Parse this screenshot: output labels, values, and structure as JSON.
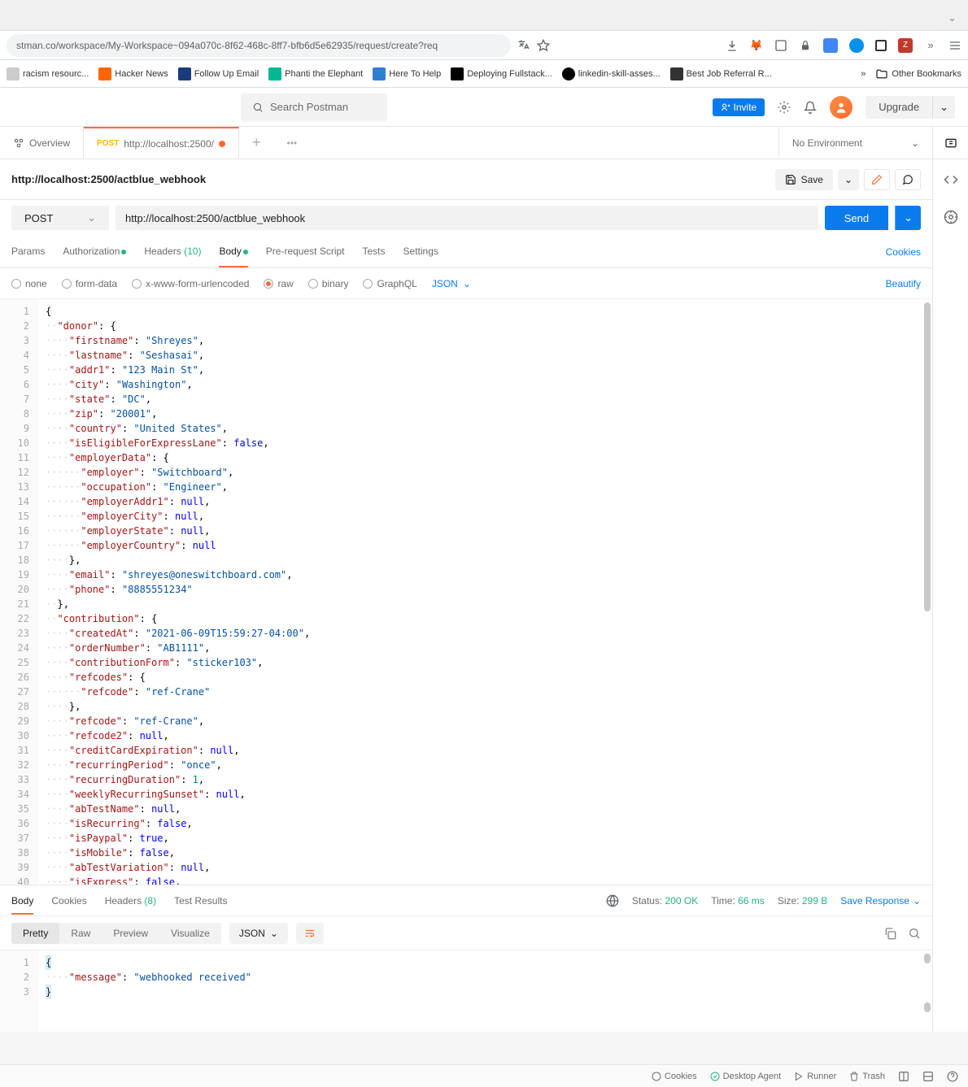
{
  "browser": {
    "url": "stman.co/workspace/My-Workspace~094a070c-8f62-468c-8ff7-bfb6d5e62935/request/create?req"
  },
  "bookmarks": [
    {
      "label": "racism resourc...",
      "cls": ""
    },
    {
      "label": "Hacker News",
      "cls": "orange"
    },
    {
      "label": "Follow Up Email",
      "cls": "darkblue"
    },
    {
      "label": "Phanti the Elephant",
      "cls": "teal"
    },
    {
      "label": "Here To Help",
      "cls": "blue"
    },
    {
      "label": "Deploying Fullstack...",
      "cls": "black"
    },
    {
      "label": "linkedin-skill-asses...",
      "cls": "github"
    },
    {
      "label": "Best Job Referral R...",
      "cls": "darkred"
    }
  ],
  "bookmarks_more": "Other Bookmarks",
  "pm": {
    "search_placeholder": "Search Postman",
    "invite": "Invite",
    "upgrade": "Upgrade",
    "overview": "Overview",
    "tab_method": "POST",
    "tab_url": "http://localhost:2500/",
    "env": "No Environment",
    "req_title": "http://localhost:2500/actblue_webhook",
    "save": "Save",
    "method": "POST",
    "url": "http://localhost:2500/actblue_webhook",
    "send": "Send",
    "req_tabs": {
      "params": "Params",
      "auth": "Authorization",
      "headers": "Headers",
      "headers_count": "(10)",
      "body": "Body",
      "prereq": "Pre-request Script",
      "tests": "Tests",
      "settings": "Settings",
      "cookies": "Cookies"
    },
    "body_types": {
      "none": "none",
      "formdata": "form-data",
      "xwww": "x-www-form-urlencoded",
      "raw": "raw",
      "binary": "binary",
      "graphql": "GraphQL",
      "json": "JSON",
      "beautify": "Beautify"
    }
  },
  "request_json_lines": [
    "{",
    "  \"donor\": {",
    "    \"firstname\": \"Shreyes\",",
    "    \"lastname\": \"Seshasai\",",
    "    \"addr1\": \"123 Main St\",",
    "    \"city\": \"Washington\",",
    "    \"state\": \"DC\",",
    "    \"zip\": \"20001\",",
    "    \"country\": \"United States\",",
    "    \"isEligibleForExpressLane\": false,",
    "    \"employerData\": {",
    "      \"employer\": \"Switchboard\",",
    "      \"occupation\": \"Engineer\",",
    "      \"employerAddr1\": null,",
    "      \"employerCity\": null,",
    "      \"employerState\": null,",
    "      \"employerCountry\": null",
    "    },",
    "    \"email\": \"shreyes@oneswitchboard.com\",",
    "    \"phone\": \"8885551234\"",
    "  },",
    "  \"contribution\": {",
    "    \"createdAt\": \"2021-06-09T15:59:27-04:00\",",
    "    \"orderNumber\": \"AB1111\",",
    "    \"contributionForm\": \"sticker103\",",
    "    \"refcodes\": {",
    "      \"refcode\": \"ref-Crane\"",
    "    },",
    "    \"refcode\": \"ref-Crane\",",
    "    \"refcode2\": null,",
    "    \"creditCardExpiration\": null,",
    "    \"recurringPeriod\": \"once\",",
    "    \"recurringDuration\": 1,",
    "    \"weeklyRecurringSunset\": null,",
    "    \"abTestName\": null,",
    "    \"isRecurring\": false,",
    "    \"isPaypal\": true,",
    "    \"isMobile\": false,",
    "    \"abTestVariation\": null,",
    "    \"isExpress\": false,"
  ],
  "response": {
    "tab_body": "Body",
    "tab_cookies": "Cookies",
    "tab_headers": "Headers",
    "tab_headers_count": "(8)",
    "tab_tests": "Test Results",
    "status_label": "Status:",
    "status_val": "200 OK",
    "time_label": "Time:",
    "time_val": "66 ms",
    "size_label": "Size:",
    "size_val": "299 B",
    "save_response": "Save Response",
    "views": {
      "pretty": "Pretty",
      "raw": "Raw",
      "preview": "Preview",
      "visualize": "Visualize",
      "json": "JSON"
    },
    "lines": [
      "{",
      "    \"message\": \"webhooked received\"",
      "}"
    ]
  },
  "footer": {
    "cookies": "Cookies",
    "desktop": "Desktop Agent",
    "runner": "Runner",
    "trash": "Trash"
  }
}
